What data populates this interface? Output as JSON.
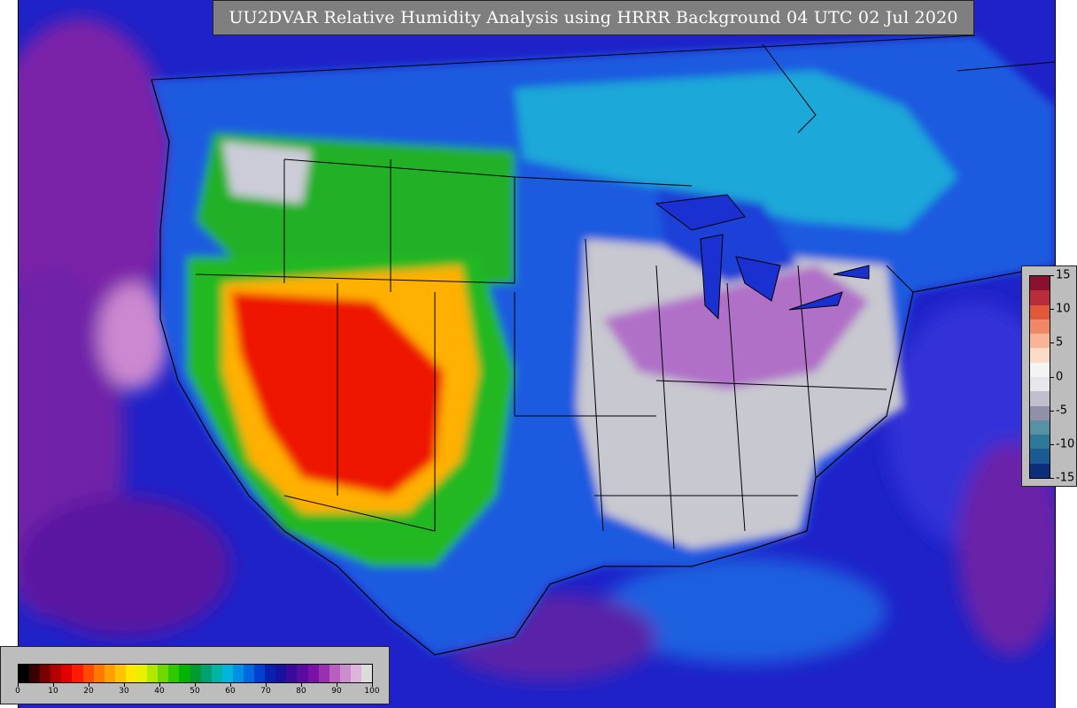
{
  "title": "UU2DVAR Relative Humidity Analysis using HRRR Background 04 UTC 02 Jul 2020",
  "rh_colorbar": {
    "ticks": [
      "0",
      "10",
      "20",
      "30",
      "40",
      "50",
      "60",
      "70",
      "80",
      "90",
      "100"
    ],
    "colors": [
      "#000000",
      "#3a0000",
      "#7a0000",
      "#b40000",
      "#e00000",
      "#ff1a00",
      "#ff4a00",
      "#ff7800",
      "#ffa000",
      "#ffc400",
      "#ffe600",
      "#e8f000",
      "#b0e800",
      "#70d800",
      "#30c800",
      "#00b400",
      "#009a30",
      "#00a070",
      "#00b4a8",
      "#00b4dc",
      "#0090e8",
      "#0068e0",
      "#0040d0",
      "#0820b0",
      "#1810a0",
      "#3a0a9a",
      "#5a0aa0",
      "#7a10a8",
      "#9a30b0",
      "#b860c0",
      "#cc8cd0",
      "#dcb4dc",
      "#dcdcdc"
    ]
  },
  "increment_colorbar": {
    "ticks": [
      "15",
      "10",
      "5",
      "0",
      "-5",
      "-10",
      "-15"
    ],
    "colors": [
      "#8a1030",
      "#b82c3c",
      "#e05a3a",
      "#f08868",
      "#f8b494",
      "#fcdcc8",
      "#f4f4f4",
      "#e8e8ec",
      "#c0c0cc",
      "#9090a8",
      "#5890a4",
      "#2c7898",
      "#1c5a94",
      "#0c2c7c"
    ]
  },
  "map": {
    "background_colors": {
      "ocean": "#2a1cc0",
      "land_dry": "#e81000",
      "land_moist": "#20b820",
      "land_humid": "#c8c8d0"
    }
  }
}
